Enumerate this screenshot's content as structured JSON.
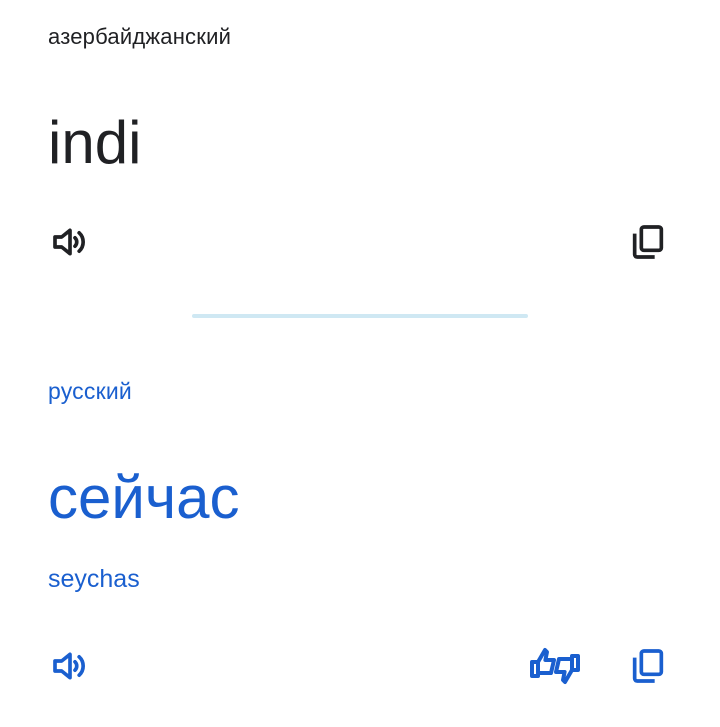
{
  "source": {
    "language": "азербайджанский",
    "text": "indi",
    "icons": {
      "speak": "volume-icon",
      "copy": "copy-icon"
    }
  },
  "target": {
    "language": "русский",
    "text": "сейчас",
    "transliteration": "seychas",
    "icons": {
      "speak": "volume-icon",
      "rate": "thumbs-rate-icon",
      "copy": "copy-icon"
    }
  },
  "colors": {
    "source_text": "#202124",
    "target_accent": "#1a5fcf",
    "divider": "#cfe8f3"
  }
}
